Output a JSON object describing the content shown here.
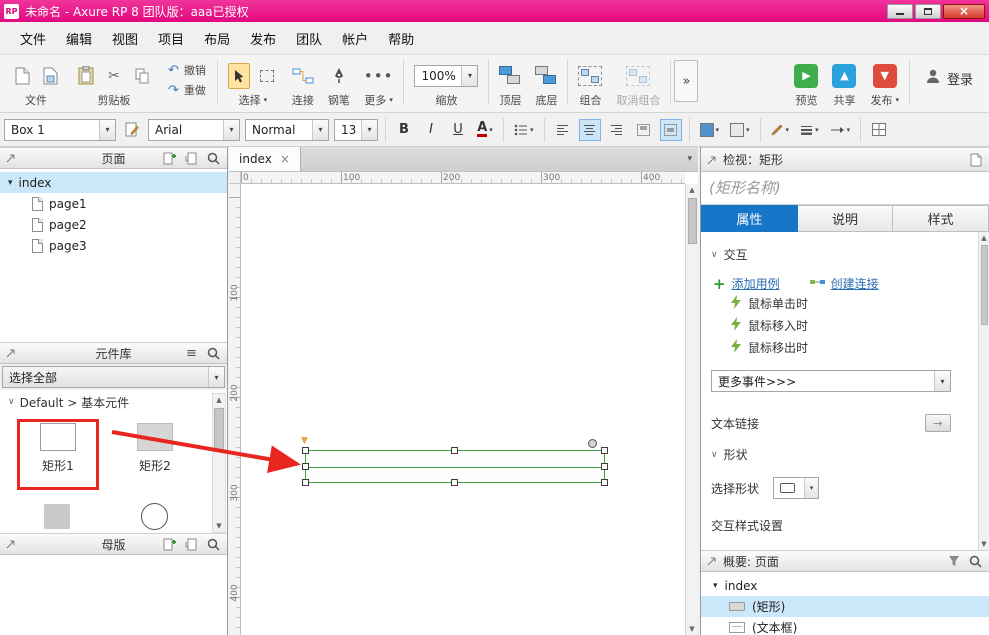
{
  "window": {
    "title": "未命名 - Axure RP 8 团队版：aaa已授权",
    "logo": "RP"
  },
  "menubar": {
    "items": [
      "文件",
      "编辑",
      "视图",
      "项目",
      "布局",
      "发布",
      "团队",
      "帐户",
      "帮助"
    ]
  },
  "toolbar": {
    "file_label": "文件",
    "clipboard_label": "剪贴板",
    "undo_label": "撤销",
    "redo_label": "重做",
    "select_label": "选择",
    "connect_label": "连接",
    "pen_label": "钢笔",
    "more_label": "更多",
    "zoom_value": "100%",
    "zoom_label": "缩放",
    "front_label": "顶层",
    "back_label": "底层",
    "group_label": "组合",
    "ungroup_label": "取消组合",
    "preview_label": "预览",
    "share_label": "共享",
    "publish_label": "发布",
    "login_label": "登录"
  },
  "stylebar": {
    "widget_style": "Box 1",
    "font_family": "Arial",
    "font_style": "Normal",
    "font_size": "13",
    "bold": "B",
    "italic": "I",
    "underline": "U",
    "font_color": "A"
  },
  "pages_panel": {
    "title": "页面",
    "root": "index",
    "children": [
      "page1",
      "page2",
      "page3"
    ]
  },
  "widgets_panel": {
    "title": "元件库",
    "filter": "选择全部",
    "section": "Default > 基本元件",
    "item1": "矩形1",
    "item2": "矩形2"
  },
  "masters_panel": {
    "title": "母版"
  },
  "canvas": {
    "tab": "index",
    "h_ruler": [
      "0",
      "100",
      "200",
      "300",
      "400"
    ],
    "v_ruler": [
      "100",
      "200",
      "300",
      "400"
    ]
  },
  "inspector": {
    "title": "检视：矩形",
    "name_placeholder": "(矩形名称)",
    "tab_properties": "属性",
    "tab_notes": "说明",
    "tab_style": "样式",
    "interaction_header": "交互",
    "add_case": "添加用例",
    "create_link": "创建连接",
    "events": [
      "鼠标单击时",
      "鼠标移入时",
      "鼠标移出时"
    ],
    "more_events": "更多事件>>>",
    "text_link": "文本链接",
    "shape_header": "形状",
    "select_shape": "选择形状",
    "interaction_style": "交互样式设置"
  },
  "outline": {
    "title": "概要: 页面",
    "items": [
      "index",
      "(矩形)",
      "(文本框)"
    ]
  },
  "colors": {
    "titlebar": "#E30880",
    "accent_blue": "#1876C8",
    "selection": "#CBE8FA",
    "link": "#2A6DB5",
    "annotation": "#E8251F",
    "shape_outline": "#3FA43F"
  }
}
